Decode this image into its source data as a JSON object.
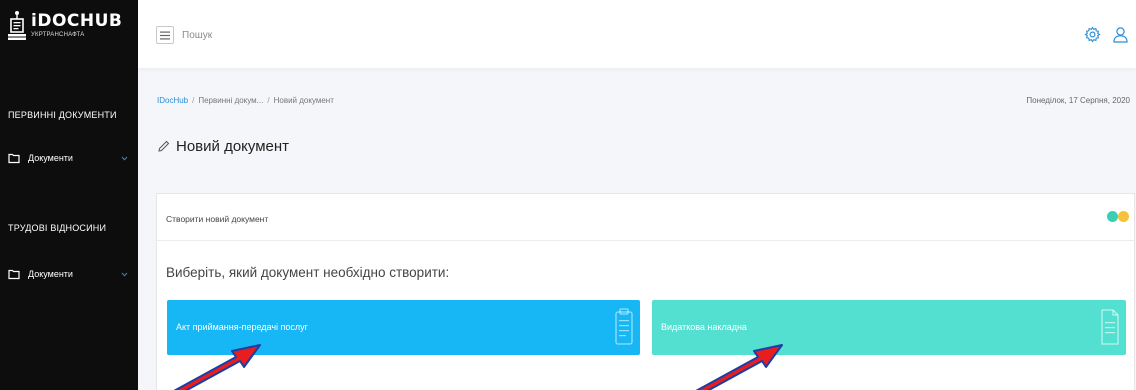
{
  "sidebar": {
    "logo": {
      "name": "iDOCHUB",
      "subtitle": "УКРТРАНСНАФТА"
    },
    "sections": [
      {
        "title": "ПЕРВИННІ ДОКУМЕНТИ",
        "item_label": "Документи"
      },
      {
        "title": "ТРУДОВІ ВІДНОСИНИ",
        "item_label": "Документи"
      }
    ]
  },
  "header": {
    "search_placeholder": "Пошук",
    "icons": [
      "menu-icon",
      "settings-icon",
      "user-icon"
    ]
  },
  "breadcrumb": {
    "items": [
      "IDocHub",
      "Первинні докум...",
      "Новий документ"
    ],
    "separator": "/"
  },
  "date": "Понеділок, 17 Серпня, 2020",
  "page_title": "Новий документ",
  "card": {
    "header_title": "Створити новий документ",
    "prompt": "Виберіть, який документ необхідно створити:",
    "tiles": [
      {
        "label": "Акт приймання-передачі послуг",
        "color": "#17b6f4",
        "icon": "clipboard-icon"
      },
      {
        "label": "Видаткова накладна",
        "color": "#53e0d0",
        "icon": "document-icon"
      }
    ]
  },
  "colors": {
    "sidebar_bg": "#0d0d0d",
    "accent_link": "#2b8fd6",
    "dot_teal": "#38d0b5",
    "dot_yellow": "#f5c23a",
    "arrow_red": "#e81d1d",
    "arrow_outline": "#1a3ea8"
  }
}
